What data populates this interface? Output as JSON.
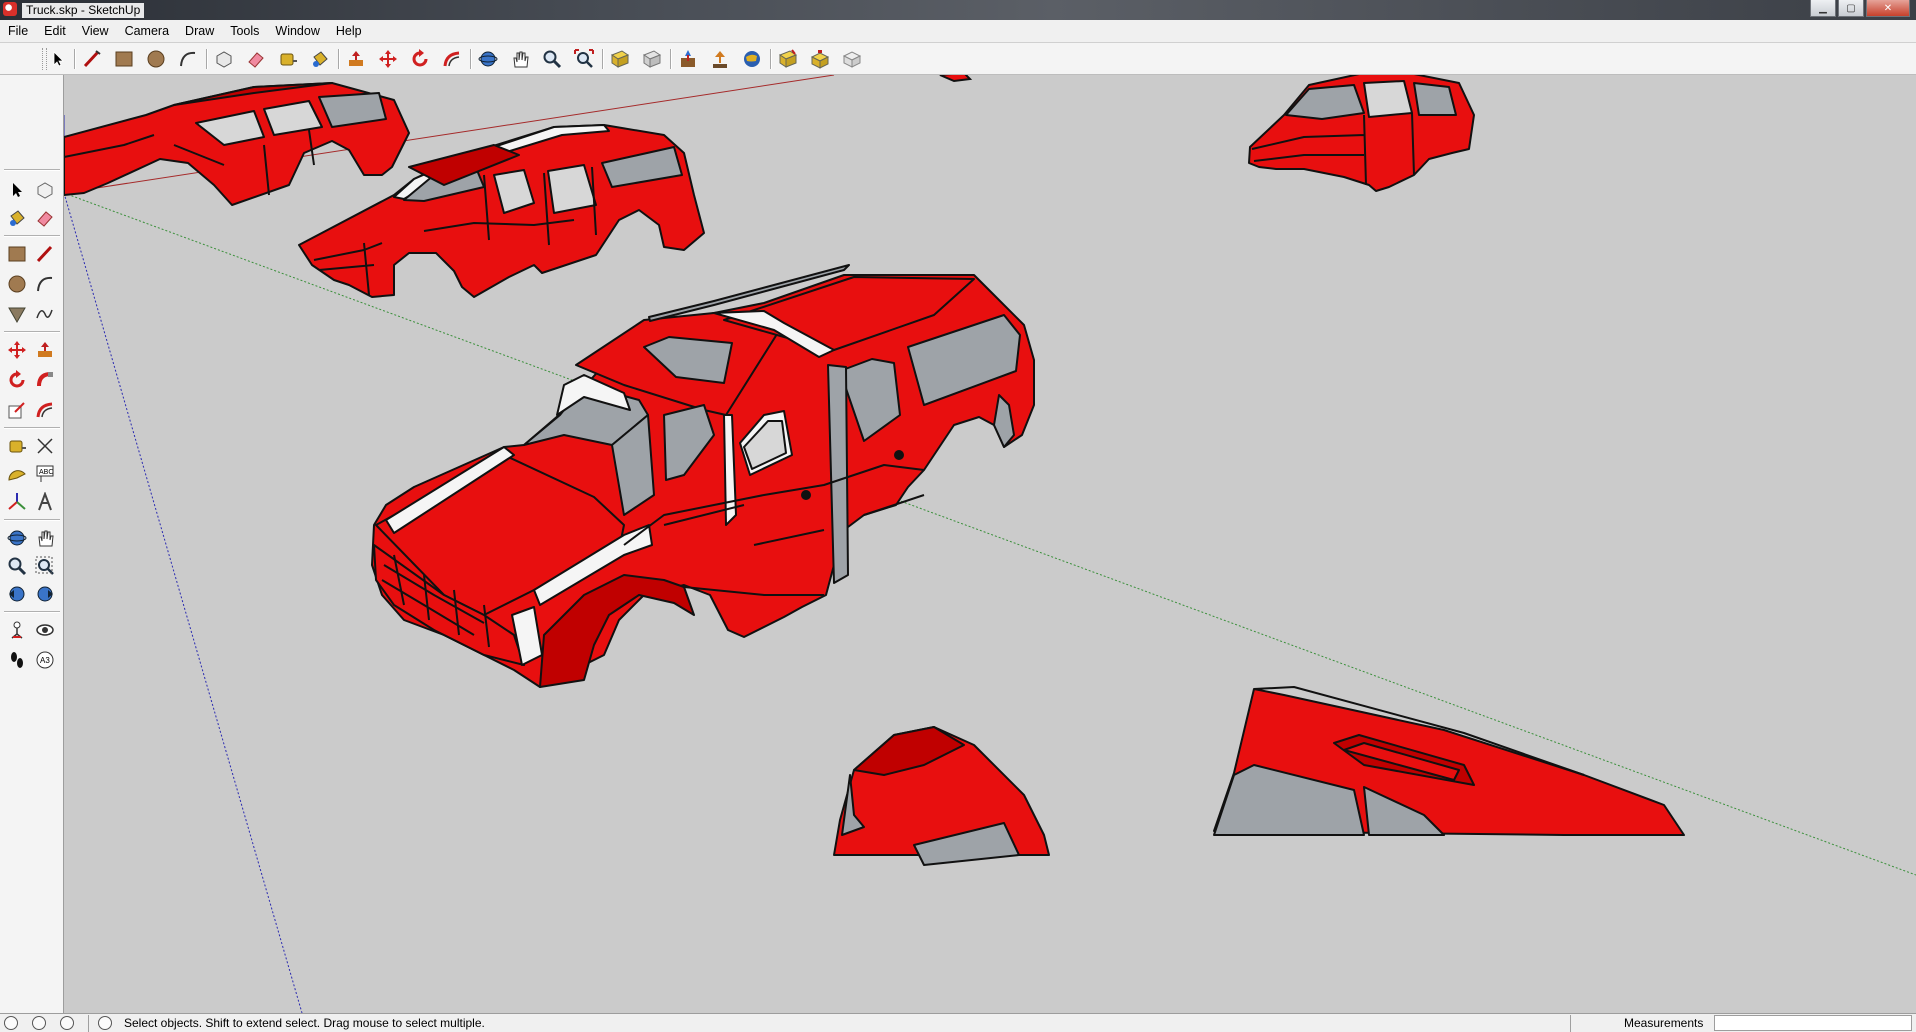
{
  "window": {
    "title": "Truck.skp - SketchUp",
    "buttons": [
      "minimize-icon",
      "maximize-icon",
      "close-icon"
    ]
  },
  "menu": [
    "File",
    "Edit",
    "View",
    "Camera",
    "Draw",
    "Tools",
    "Window",
    "Help"
  ],
  "toolbar_top": [
    "select-icon",
    "line-icon",
    "rectangle-icon",
    "circle-icon",
    "arc-icon",
    "make-component-icon",
    "eraser-icon",
    "tape-measure-icon",
    "paint-bucket-icon",
    "push-pull-icon",
    "move-icon",
    "rotate-icon",
    "offset-icon",
    "orbit-icon",
    "pan-icon",
    "zoom-icon",
    "zoom-extents-icon",
    "get-models-icon",
    "share-model-icon",
    "share-component-icon",
    "add-location-icon",
    "toggle-terrain-icon",
    "preview-in-google-earth-icon",
    "get-photo-textures-icon",
    "extension-warehouse-icon",
    "style-builder-icon"
  ],
  "toolbar_left": [
    "select-icon",
    "make-component-icon",
    "paint-bucket-icon",
    "eraser-icon",
    "rectangle-icon",
    "line-icon",
    "circle-icon",
    "arc-icon",
    "polygon-icon",
    "freehand-icon",
    "move-icon",
    "push-pull-icon",
    "rotate-icon",
    "follow-me-icon",
    "scale-icon",
    "offset-icon",
    "tape-measure-icon",
    "dimension-icon",
    "protractor-icon",
    "text-icon",
    "axes-icon",
    "3d-text-icon",
    "orbit-icon",
    "pan-icon",
    "zoom-icon",
    "zoom-window-icon",
    "previous-view-icon",
    "next-view-icon",
    "position-camera-icon",
    "look-around-icon",
    "walk-icon",
    "section-plane-icon"
  ],
  "statusbar": {
    "icons": [
      "geo-location-icon",
      "credits-icon",
      "user-icon",
      "help-icon"
    ],
    "message": "Select objects. Shift to extend select. Drag mouse to select multiple.",
    "measurements_label": "Measurements",
    "measurements_value": ""
  },
  "colors": {
    "viewport_bg": "#cbcbcb",
    "model_red": "#e80f0f",
    "model_dark_red": "#a80000",
    "glass_gray": "#9ea3a8",
    "axis_red": "#a52a2a",
    "axis_green": "#3a8f3a",
    "axis_blue": "#2b2bb0"
  }
}
